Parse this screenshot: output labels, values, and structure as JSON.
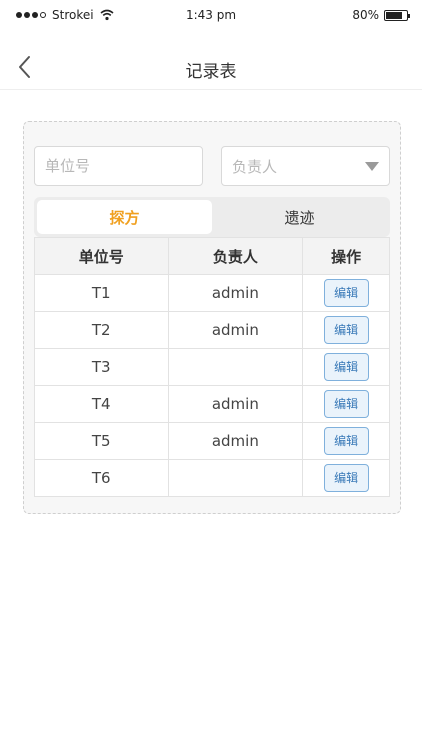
{
  "status_bar": {
    "carrier": "Strokei",
    "time": "1:43 pm",
    "battery": "80%",
    "battery_level": 0.8
  },
  "nav": {
    "title": "记录表",
    "back_icon": "chevron-left-icon"
  },
  "filters": {
    "unit_placeholder": "单位号",
    "owner_placeholder": "负责人"
  },
  "tabs": [
    {
      "label": "探方",
      "active": true
    },
    {
      "label": "遗迹",
      "active": false
    }
  ],
  "table": {
    "headers": [
      "单位号",
      "负责人",
      "操作"
    ],
    "rows": [
      {
        "unit": "T1",
        "owner": "admin",
        "action": "编辑"
      },
      {
        "unit": "T2",
        "owner": "admin",
        "action": "编辑"
      },
      {
        "unit": "T3",
        "owner": "",
        "action": "编辑"
      },
      {
        "unit": "T4",
        "owner": "admin",
        "action": "编辑"
      },
      {
        "unit": "T5",
        "owner": "admin",
        "action": "编辑"
      },
      {
        "unit": "T6",
        "owner": "",
        "action": "编辑"
      }
    ]
  },
  "colors": {
    "active_tab": "#f0a020",
    "edit_button_text": "#3a7ab8",
    "edit_button_border": "#7fb0dc"
  }
}
